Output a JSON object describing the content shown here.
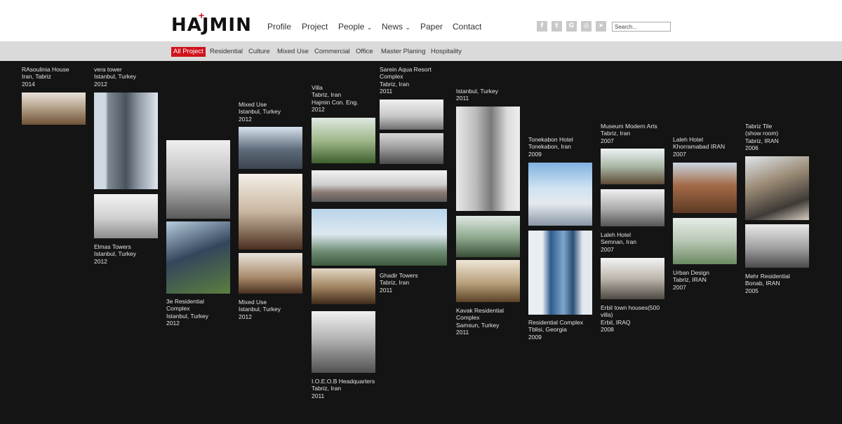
{
  "brand": {
    "logo_text": "HAJMIN",
    "logo_mark": "+"
  },
  "nav": {
    "profile": "Profile",
    "project": "Project",
    "people": "People",
    "news": "News",
    "paper": "Paper",
    "contact": "Contact",
    "chevron": "⌄"
  },
  "social": {
    "facebook": "f",
    "twitter": "t",
    "google": "G",
    "instagram": "◎",
    "telegram": "➤"
  },
  "search": {
    "placeholder": "Search..."
  },
  "filters": {
    "all": "All Project",
    "residential": "Residential",
    "culture": "Culture",
    "mixed": "Mixed Use",
    "commercial": "Commercial",
    "office": "Office",
    "master": "Master Planing",
    "hospitality": "Hospitality"
  },
  "colors": {
    "accent": "#d0121c",
    "background": "#141414",
    "header": "#ffffff",
    "filterbar": "#dadada"
  },
  "projects": {
    "rasoulinia": [
      "RAsoulinia House",
      "Iran, Tabriz",
      "2014"
    ],
    "vera": [
      "vera tower",
      "Istanbul, Turkey",
      "2012"
    ],
    "elmas": [
      "Elmas Towers",
      "Istanbul, Turkey",
      "2012"
    ],
    "threee": [
      "3e Residential",
      "Complex",
      "Istanbul, Turkey",
      "2012"
    ],
    "mixed1": [
      "Mixed Use",
      "Istanbul, Turkey",
      "2012"
    ],
    "mixed2": [
      "Mixed Use",
      "Istanbul, Turkey",
      "2012"
    ],
    "villa": [
      "Villa",
      "Tabriz, Iran",
      "Hajmin Con. Eng.",
      "2012"
    ],
    "ioeob": [
      "I.O.E.O.B Headquarters",
      "Tabriz, Iran",
      "2011"
    ],
    "sarein": [
      "Sarein Aqua Resort",
      "Complex",
      "Tabriz, Iran",
      "2011"
    ],
    "ghadir": [
      "Ghadir Towers",
      "Tabriz, Iran",
      "2011"
    ],
    "istanbul": [
      "Istanbul, Turkey",
      "2011"
    ],
    "kavak": [
      "Kavak Residential",
      "Complex",
      "Samsun, Turkey",
      "2011"
    ],
    "tonekabon": [
      "Tonekabon Hotel",
      "Tonekabon, Iran",
      "2009"
    ],
    "resTbilisi": [
      "Residential Complex",
      "Tblisi, Georgia",
      "2009"
    ],
    "museum": [
      "Museum Modern Arts",
      "Tabriz, Iran",
      "2007"
    ],
    "lalehSemnan": [
      "Laleh Hotel",
      "Semnan, Iran",
      "2007"
    ],
    "erbil": [
      "Erbil town houses(500",
      "villa)",
      "Erbil, IRAQ",
      "2008"
    ],
    "lalehKhor": [
      "Laleh Hotel",
      "Khorramabad IRAN",
      "2007"
    ],
    "urban": [
      "Urban Design",
      "Tabriz, IRAN",
      "2007"
    ],
    "tabrizTile": [
      "Tabriz Tile",
      "(show room)",
      "Tabriz, IRAN",
      "2006"
    ],
    "mehr": [
      "Mehr Residential",
      "Bonab, IRAN",
      "2005"
    ]
  }
}
